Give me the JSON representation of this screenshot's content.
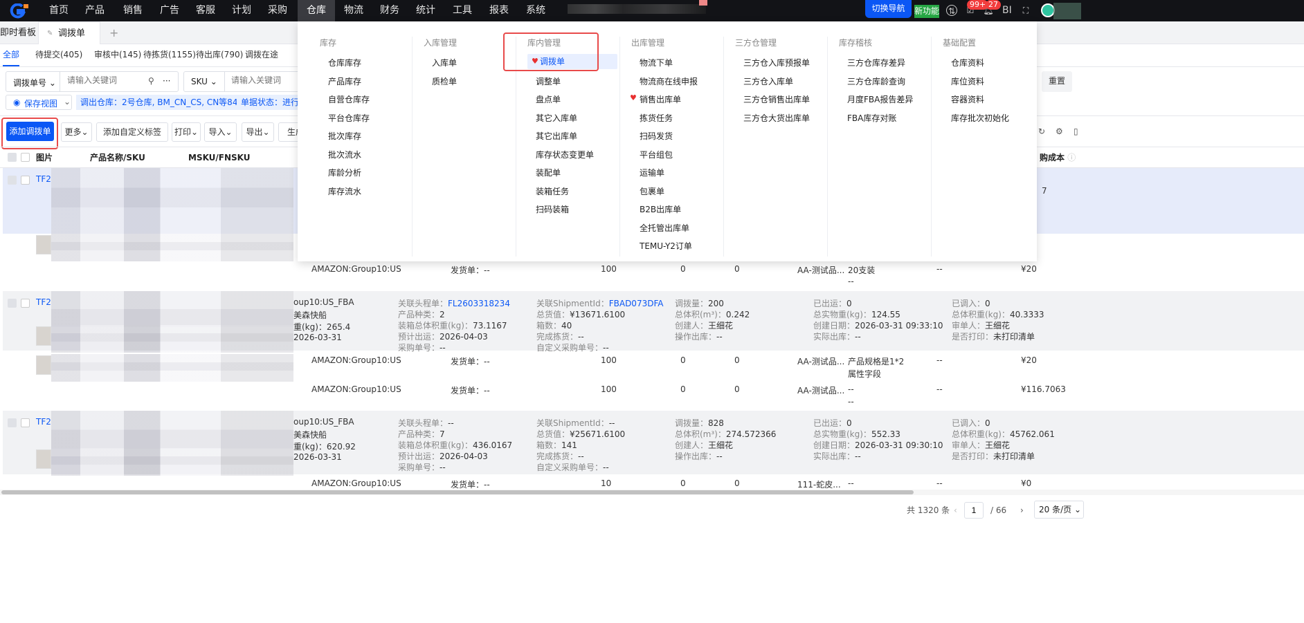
{
  "topnav": {
    "items": [
      "首页",
      "产品",
      "销售",
      "广告",
      "客服",
      "计划",
      "采购",
      "仓库",
      "物流",
      "财务",
      "统计",
      "工具",
      "报表",
      "系统"
    ],
    "active": "仓库",
    "switch_nav": "切换导航",
    "new_feature": "新功能",
    "badge_tasks": "99+",
    "badge_notices": "27",
    "bi": "BI"
  },
  "page_tabs": {
    "dashboard": "即时看板",
    "current": "调拨单",
    "add": "+"
  },
  "status_tabs": [
    "全部",
    "待提交(405)",
    "审核中(145)",
    "待拣货(1155)",
    "待出库(790)",
    "调拨在途"
  ],
  "filters": {
    "field1": "调拨单号",
    "placeholder1": "请输入关键词",
    "more": "···",
    "field2": "SKU",
    "placeholder2": "请输入关键词",
    "reset": "重置",
    "save_view": "保存视图",
    "chip1": "调出仓库：2号仓库, BM_CN_CS, CN等84项",
    "chip2": "单据状态：进行中"
  },
  "actions": {
    "add": "添加调拨单",
    "more": "更多",
    "add_tag": "添加自定义标签",
    "print": "打印",
    "import": "导入",
    "export": "导出",
    "generate": "生成"
  },
  "table": {
    "headers": {
      "image": "图片",
      "name": "产品名称/SKU",
      "msku": "MSKU/FNSKU",
      "cost": "购成本"
    },
    "groups": [
      {
        "id": "TF2",
        "lines": [],
        "details": [],
        "rows": [
          {
            "msku": "AMAZON:Group10:US",
            "ship": "发货单：--",
            "qty": "100",
            "a": "0",
            "b": "0",
            "prod": "AA-测试品...",
            "spec": [
              "20支装",
              "--"
            ],
            "dash": "--",
            "price": "¥20"
          }
        ],
        "partial": [
          "7"
        ]
      },
      {
        "id": "TF2",
        "lines": [
          "oup10:US_FBA",
          "美森快船",
          "重(kg)：265.4",
          "2026-03-31"
        ],
        "details": [
          [
            {
              "k": "关联头程单：",
              "v": "FL2603318234",
              "link": true
            },
            {
              "k": "产品种类：",
              "v": "2"
            },
            {
              "k": "装箱总体积重(kg)：",
              "v": "73.1167"
            },
            {
              "k": "预计出运：",
              "v": "2026-04-03"
            },
            {
              "k": "采购单号：",
              "v": "--"
            }
          ],
          [
            {
              "k": "关联ShipmentId：",
              "v": "FBAD073DFA",
              "link": true
            },
            {
              "k": "总货值：",
              "v": "¥13671.6100"
            },
            {
              "k": "箱数：",
              "v": "40"
            },
            {
              "k": "完成拣货：",
              "v": "--"
            },
            {
              "k": "自定义采购单号：",
              "v": "--"
            }
          ],
          [
            {
              "k": "调拨量：",
              "v": "200"
            },
            {
              "k": "总体积(m³)：",
              "v": "0.242"
            },
            {
              "k": "创建人：",
              "v": "王细花"
            },
            {
              "k": "操作出库：",
              "v": "--"
            }
          ],
          [
            {
              "k": "已出运：",
              "v": "0"
            },
            {
              "k": "总实物重(kg)：",
              "v": "124.55"
            },
            {
              "k": "创建日期：",
              "v": "2026-03-31 09:33:10"
            },
            {
              "k": "实际出库：",
              "v": "--"
            }
          ],
          [
            {
              "k": "已调入：",
              "v": "0"
            },
            {
              "k": "总体积重(kg)：",
              "v": "40.3333"
            },
            {
              "k": "审单人：",
              "v": "王细花"
            },
            {
              "k": "是否打印：",
              "v": "未打印清单"
            }
          ]
        ],
        "rows": [
          {
            "msku": "AMAZON:Group10:US",
            "ship": "发货单：--",
            "qty": "100",
            "a": "0",
            "b": "0",
            "prod": "AA-测试品...",
            "spec": [
              "产品规格是1*2",
              "属性字段"
            ],
            "dash": "--",
            "price": "¥20"
          },
          {
            "msku": "AMAZON:Group10:US",
            "ship": "发货单：--",
            "qty": "100",
            "a": "0",
            "b": "0",
            "prod": "AA-测试品...",
            "spec": [
              "--",
              "--"
            ],
            "dash": "--",
            "price": "¥116.7063"
          }
        ]
      },
      {
        "id": "TF2",
        "lines": [
          "oup10:US_FBA",
          "美森快船",
          "重(kg)：620.92",
          "2026-03-31"
        ],
        "details": [
          [
            {
              "k": "关联头程单：",
              "v": "--"
            },
            {
              "k": "产品种类：",
              "v": "7"
            },
            {
              "k": "装箱总体积重(kg)：",
              "v": "436.0167"
            },
            {
              "k": "预计出运：",
              "v": "2026-04-03"
            },
            {
              "k": "采购单号：",
              "v": "--"
            }
          ],
          [
            {
              "k": "关联ShipmentId：",
              "v": "--"
            },
            {
              "k": "总货值：",
              "v": "¥25671.6100"
            },
            {
              "k": "箱数：",
              "v": "141"
            },
            {
              "k": "完成拣货：",
              "v": "--"
            },
            {
              "k": "自定义采购单号：",
              "v": "--"
            }
          ],
          [
            {
              "k": "调拨量：",
              "v": "828"
            },
            {
              "k": "总体积(m³)：",
              "v": "274.572366"
            },
            {
              "k": "创建人：",
              "v": "王细花"
            },
            {
              "k": "操作出库：",
              "v": "--"
            }
          ],
          [
            {
              "k": "已出运：",
              "v": "0"
            },
            {
              "k": "总实物重(kg)：",
              "v": "552.33"
            },
            {
              "k": "创建日期：",
              "v": "2026-03-31 09:30:10"
            },
            {
              "k": "实际出库：",
              "v": "--"
            }
          ],
          [
            {
              "k": "已调入：",
              "v": "0"
            },
            {
              "k": "总体积重(kg)：",
              "v": "45762.061"
            },
            {
              "k": "审单人：",
              "v": "王细花"
            },
            {
              "k": "是否打印：",
              "v": "未打印清单"
            }
          ]
        ],
        "rows": [
          {
            "msku": "AMAZON:Group10:US",
            "ship": "发货单：--",
            "qty": "10",
            "a": "0",
            "b": "0",
            "prod": "111-蛇皮...",
            "spec": [
              "--",
              ""
            ],
            "dash": "--",
            "price": "¥0"
          }
        ]
      }
    ]
  },
  "pagination": {
    "total": "共 1320 条",
    "page": "1",
    "pages": "/ 66",
    "size": "20 条/页"
  },
  "menu": {
    "columns": [
      {
        "title": "库存",
        "items": [
          "仓库库存",
          "产品库存",
          "自营仓库存",
          "平台仓库存",
          "批次库存",
          "批次流水",
          "库龄分析",
          "库存流水"
        ]
      },
      {
        "title": "入库管理",
        "items": [
          "入库单",
          "质检单"
        ]
      },
      {
        "title": "库内管理",
        "items": [
          "调拨单",
          "调整单",
          "盘点单",
          "其它入库单",
          "其它出库单",
          "库存状态变更单",
          "装配单",
          "装箱任务",
          "扫码装箱"
        ],
        "active": 0,
        "fav": [
          0
        ]
      },
      {
        "title": "出库管理",
        "items": [
          "物流下单",
          "物流商在线申报",
          "销售出库单",
          "拣货任务",
          "扫码发货",
          "平台组包",
          "运输单",
          "包裹单",
          "B2B出库单",
          "全托管出库单",
          "TEMU-Y2订单"
        ],
        "fav": [
          2
        ]
      },
      {
        "title": "三方仓管理",
        "items": [
          "三方仓入库预报单",
          "三方仓入库单",
          "三方仓销售出库单",
          "三方仓大货出库单"
        ]
      },
      {
        "title": "库存稽核",
        "items": [
          "三方仓库存差异",
          "三方仓库龄查询",
          "月度FBA报告差异",
          "FBA库存对账"
        ]
      },
      {
        "title": "基础配置",
        "items": [
          "仓库资料",
          "库位资料",
          "容器资料",
          "库存批次初始化"
        ]
      }
    ]
  },
  "colors": {
    "accent": "#0b57f5",
    "highlight": "#e84a4a",
    "nav_bg": "#121317"
  }
}
